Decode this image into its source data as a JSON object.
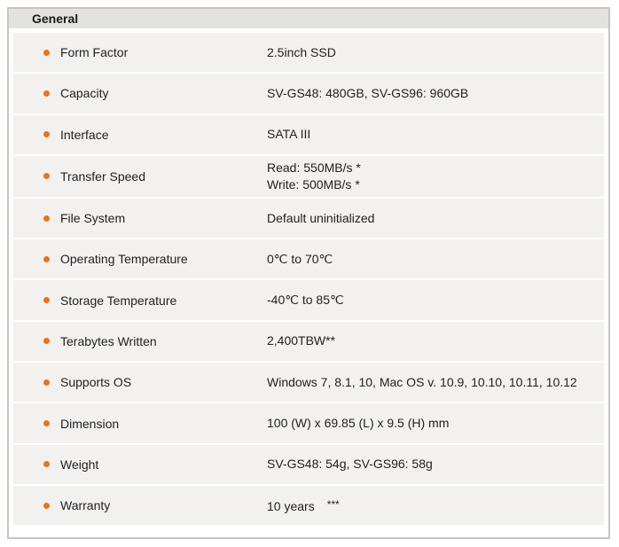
{
  "section": {
    "title": "General"
  },
  "colors": {
    "bullet": "#e8731c",
    "row_background": "#f2f1ef",
    "header_background": "#e4e2df",
    "frame_border": "#c8c4c0"
  },
  "specs": [
    {
      "label": "Form Factor",
      "value": "2.5inch SSD"
    },
    {
      "label": "Capacity",
      "value": "SV-GS48: 480GB, SV-GS96: 960GB"
    },
    {
      "label": "Interface",
      "value": "SATA III"
    },
    {
      "label": "Transfer Speed",
      "value_lines": [
        "Read: 550MB/s *",
        "Write: 500MB/s *"
      ]
    },
    {
      "label": "File System",
      "value": "Default uninitialized"
    },
    {
      "label": "Operating Temperature",
      "value": "0℃ to 70℃"
    },
    {
      "label": "Storage Temperature",
      "value": "-40℃ to 85℃"
    },
    {
      "label": "Terabytes Written",
      "value": "2,400TBW**"
    },
    {
      "label": "Supports OS",
      "value": "Windows 7, 8.1, 10, Mac OS v. 10.9, 10.10, 10.11, 10.12"
    },
    {
      "label": "Dimension",
      "value": "100 (W) x 69.85 (L) x 9.5 (H) mm"
    },
    {
      "label": "Weight",
      "value": "SV-GS48: 54g, SV-GS96: 58g"
    },
    {
      "label": "Warranty",
      "value": "10 years",
      "note": "***"
    }
  ]
}
